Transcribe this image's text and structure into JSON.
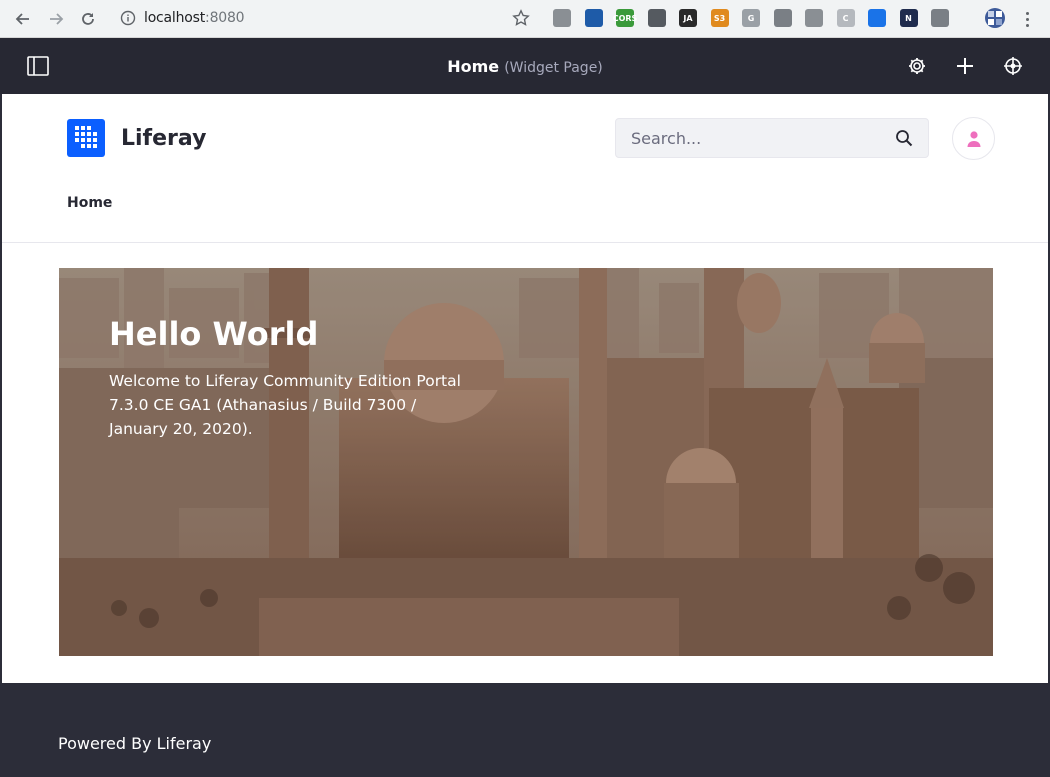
{
  "browser": {
    "url_host": "localhost",
    "url_port": ":8080",
    "extensions": [
      {
        "name": "ext-gray-page-icon",
        "color": "#8a8f94",
        "label": ""
      },
      {
        "name": "ext-blue-screen-icon",
        "color": "#1e5ba8",
        "label": ""
      },
      {
        "name": "ext-cors-icon",
        "color": "#3a9a3a",
        "label": "CORS"
      },
      {
        "name": "ext-eyedropper-icon",
        "color": "#555a60",
        "label": ""
      },
      {
        "name": "ext-ja-icon",
        "color": "#2a2a2a",
        "label": "JA"
      },
      {
        "name": "ext-s3-icon",
        "color": "#e08a1e",
        "label": "S3"
      },
      {
        "name": "ext-g-icon",
        "color": "#9aa0a6",
        "label": "G"
      },
      {
        "name": "ext-camera-icon",
        "color": "#7a7f85",
        "label": ""
      },
      {
        "name": "ext-refresh-icon",
        "color": "#8a8f94",
        "label": ""
      },
      {
        "name": "ext-c-circle-icon",
        "color": "#b5b9be",
        "label": "C"
      },
      {
        "name": "ext-download-icon",
        "color": "#1a73e8",
        "label": ""
      },
      {
        "name": "ext-n-icon",
        "color": "#1f2b4d",
        "label": "N"
      },
      {
        "name": "ext-window-icon",
        "color": "#7a7f85",
        "label": ""
      }
    ]
  },
  "control_bar": {
    "title": "Home",
    "subtitle": "(Widget Page)",
    "bg_color": "#272833"
  },
  "header": {
    "site_name": "Liferay",
    "search_placeholder": "Search...",
    "nav_items": [
      "Home"
    ],
    "brand_color": "#0b5fff",
    "avatar_color": "#ee6fbd"
  },
  "hero": {
    "title": "Hello World",
    "text": "Welcome to Liferay Community Edition Portal 7.3.0 CE GA1 (Athanasius / Build 7300 / January 20, 2020)."
  },
  "footer": {
    "text": "Powered By Liferay"
  }
}
